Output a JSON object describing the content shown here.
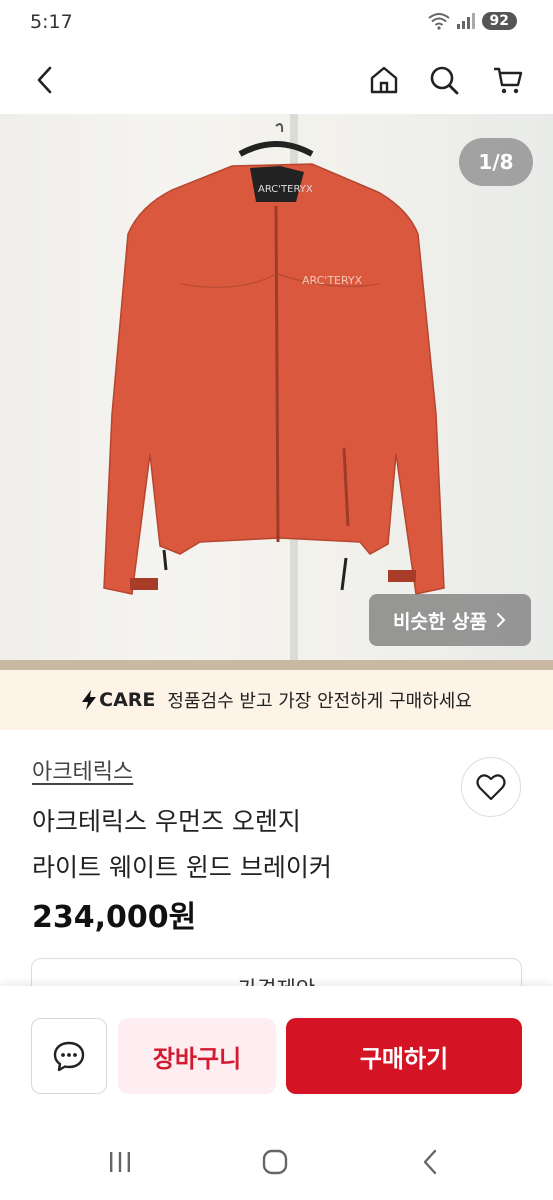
{
  "status_bar": {
    "time": "5:17",
    "battery": "92"
  },
  "header": {
    "back_icon": "chevron-left-icon",
    "home_icon": "home-icon",
    "search_icon": "search-icon",
    "cart_icon": "cart-icon"
  },
  "gallery": {
    "counter": "1/8",
    "similar_label": "비슷한 상품"
  },
  "care_banner": {
    "brand": "CARE",
    "message": "정품검수 받고 가장 안전하게 구매하세요"
  },
  "product": {
    "brand": "아크테릭스",
    "title_line1": "아크테릭스 우먼즈 오렌지",
    "title_line2": "라이트 웨이트 윈드 브레이커",
    "price": "234,000원",
    "jacket_color": "#d9583e"
  },
  "offer_button": "가격제안",
  "bottom_bar": {
    "cart_label": "장바구니",
    "buy_label": "구매하기",
    "accent_color": "#d41425"
  }
}
